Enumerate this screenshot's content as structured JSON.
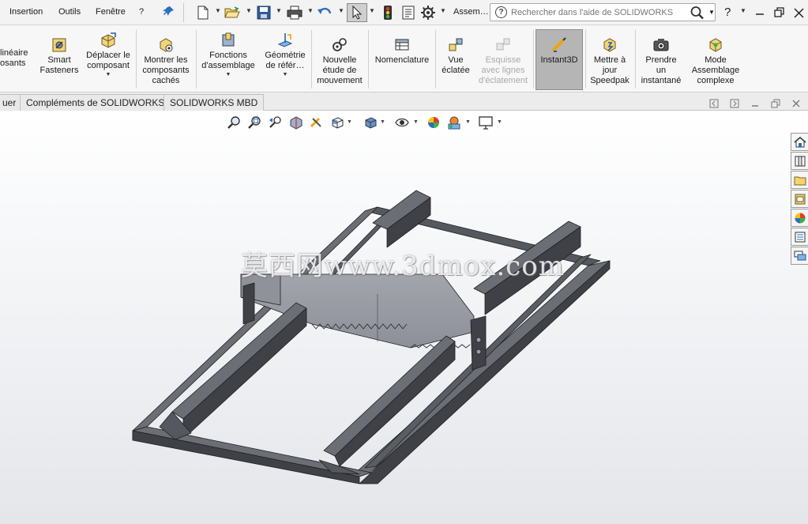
{
  "menubar": {
    "items": [
      "Insertion",
      "Outils",
      "Fenêtre",
      "?"
    ],
    "context_label": "Assem…",
    "search": {
      "placeholder": "Rechercher dans l'aide de SOLIDWORKS"
    },
    "help_label": "?"
  },
  "ribbon": {
    "commands": [
      {
        "id": "lineaire",
        "label": "linéaire\nosants",
        "caret": false,
        "disabled": false,
        "active": false
      },
      {
        "id": "smart-fasteners",
        "label": "Smart\nFasteners",
        "caret": false,
        "disabled": false,
        "active": false
      },
      {
        "id": "deplacer",
        "label": "Déplacer le\ncomposant",
        "caret": true,
        "disabled": false,
        "active": false
      },
      {
        "id": "montrer",
        "label": "Montrer les\ncomposants\ncachés",
        "caret": false,
        "disabled": false,
        "active": false
      },
      {
        "id": "fonctions",
        "label": "Fonctions\nd'assemblage",
        "caret": true,
        "disabled": false,
        "active": false
      },
      {
        "id": "geometrie",
        "label": "Géométrie\nde référ…",
        "caret": true,
        "disabled": false,
        "active": false
      },
      {
        "id": "etude",
        "label": "Nouvelle\nétude de\nmouvement",
        "caret": false,
        "disabled": false,
        "active": false
      },
      {
        "id": "nomenclature",
        "label": "Nomenclature",
        "caret": false,
        "disabled": false,
        "active": false
      },
      {
        "id": "vue-eclatee",
        "label": "Vue\néclatée",
        "caret": false,
        "disabled": false,
        "active": false
      },
      {
        "id": "esquisse",
        "label": "Esquisse\navec lignes\nd'éclatement",
        "caret": false,
        "disabled": true,
        "active": false
      },
      {
        "id": "instant3d",
        "label": "Instant3D",
        "caret": false,
        "disabled": false,
        "active": true
      },
      {
        "id": "speedpak",
        "label": "Mettre à\njour\nSpeedpak",
        "caret": false,
        "disabled": false,
        "active": false
      },
      {
        "id": "instantane",
        "label": "Prendre\nun\ninstantané",
        "caret": false,
        "disabled": false,
        "active": false
      },
      {
        "id": "assemblage-complexe",
        "label": "Mode\nAssemblage\ncomplexe",
        "caret": false,
        "disabled": false,
        "active": false
      }
    ]
  },
  "tabs": [
    {
      "label": "uer"
    },
    {
      "label": "Compléments de SOLIDWORKS"
    },
    {
      "label": "SOLIDWORKS MBD"
    }
  ],
  "viewport": {
    "watermark": "莫西网www.3dmox.com",
    "hud_icons": [
      "zoom-to-fit-icon",
      "zoom-area-icon",
      "previous-view-icon",
      "section-view-icon",
      "dynamic-annotation-icon",
      "view-orientation-icon",
      "display-style-icon",
      "hide-show-icon",
      "edit-appearance-icon",
      "apply-scene-icon",
      "view-settings-icon"
    ],
    "taskpane_icons": [
      "home-icon",
      "design-library-icon",
      "file-explorer-icon",
      "view-palette-icon",
      "appearances-icon",
      "custom-properties-icon",
      "forum-icon"
    ]
  },
  "colors": {
    "accent": "#2a6fc0",
    "model_top": "#6b6e74",
    "model_side": "#3f4146",
    "model_dark": "#2e3034",
    "blade": "#9a9ca4"
  }
}
